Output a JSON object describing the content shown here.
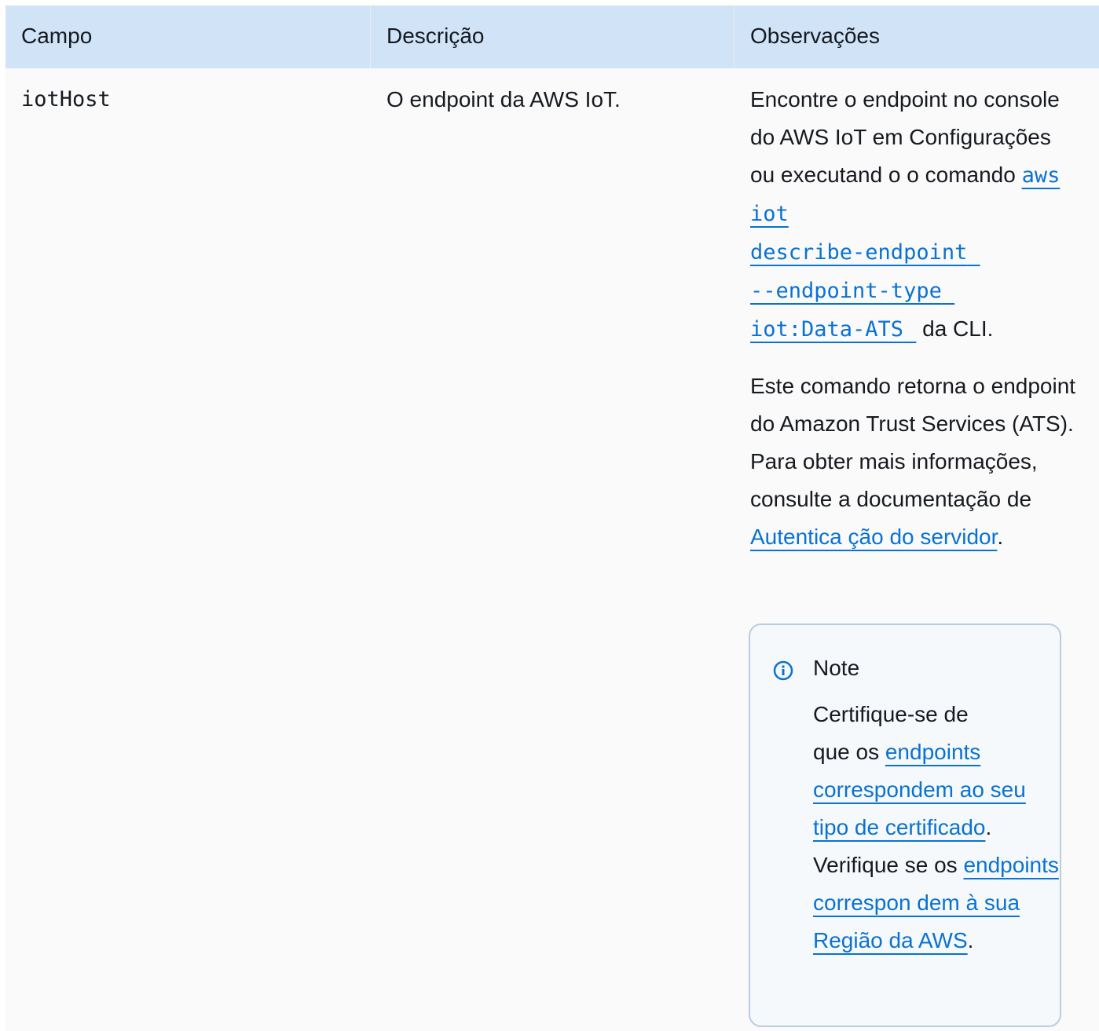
{
  "table": {
    "headers": {
      "field": "Campo",
      "description": "Descrição",
      "notes": "Observações"
    },
    "row": {
      "field": "iotHost",
      "description": "O endpoint da AWS IoT.",
      "notes": {
        "p1_prefix": "Encontre o endpoint no console do AWS IoT em Configurações ou executand o o comando ",
        "p1_cmd_l1": "aws iot",
        "p1_cmd_l2": "describe-endpoint",
        "p1_cmd_l3": "--endpoint-type",
        "p1_cmd_l4": "iot:Data-ATS",
        "p1_suffix": " da CLI.",
        "p2_prefix": "Este comando retorna o endpoint do Amazon Trust Services (ATS). Para obter mais informações, consulte a documentação de ",
        "p2_link": "Autentica ção do servidor",
        "p2_suffix": ".",
        "note": {
          "title": "Note",
          "line1": "Certifique-se de",
          "line2_prefix": "que os ",
          "link1": "endpoints correspondem ao seu tipo de certificado",
          "mid": ". Verifique se os ",
          "link2": "endpoints correspon dem à sua Região da AWS",
          "end": "."
        }
      }
    }
  }
}
